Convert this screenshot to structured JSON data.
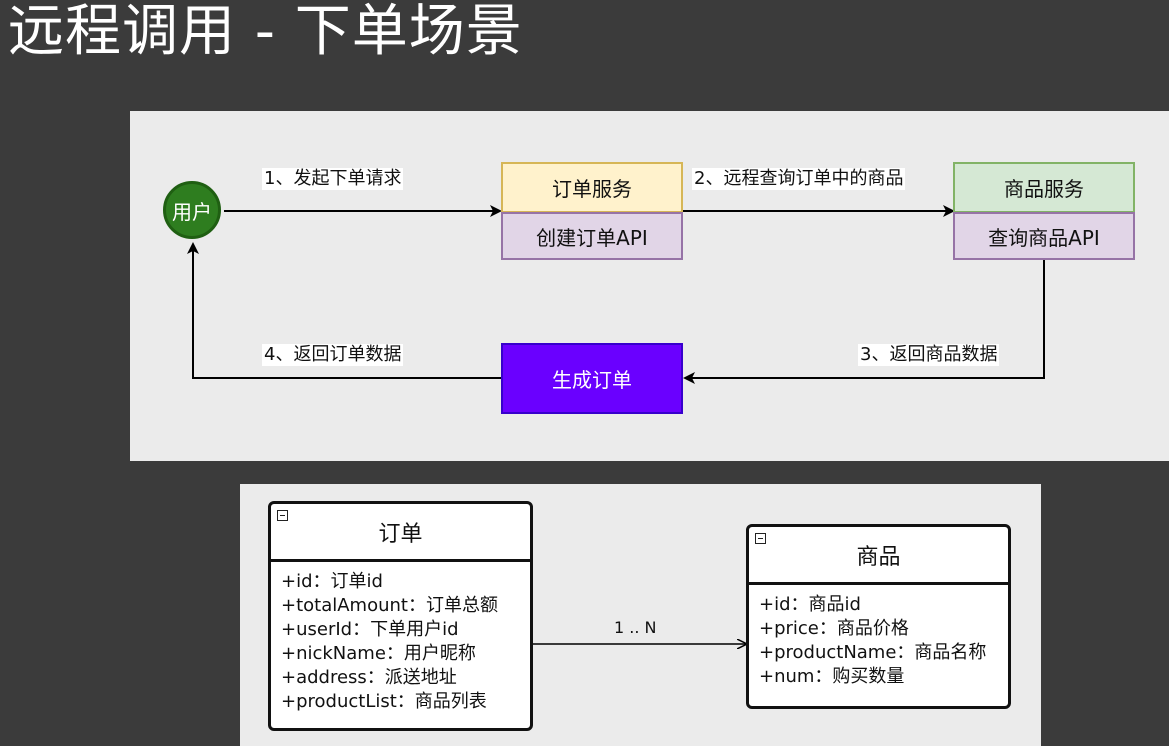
{
  "title": "远程调用 - 下单场景",
  "flow": {
    "user_label": "用户",
    "order_service": {
      "title": "订单服务",
      "api": "创建订单API"
    },
    "product_service": {
      "title": "商品服务",
      "api": "查询商品API"
    },
    "generate_order": "生成订单",
    "edges": {
      "step1": "1、发起下单请求",
      "step2": "2、远程查询订单中的商品",
      "step3": "3、返回商品数据",
      "step4": "4、返回订单数据"
    },
    "colors": {
      "user_fill": "#2e7d1f",
      "service_title_order": "#fff2cc",
      "service_title_product": "#d5e8d4",
      "api_fill": "#e1d5e7",
      "generate_fill": "#6a00ff"
    }
  },
  "uml": {
    "order_class": {
      "name": "订单",
      "fields": [
        "+id：订单id",
        "+totalAmount：订单总额",
        "+userId：下单用户id",
        "+nickName：用户昵称",
        "+address：派送地址",
        "+productList：商品列表"
      ]
    },
    "product_class": {
      "name": "商品",
      "fields": [
        "+id：商品id",
        "+price：商品价格",
        "+productName：商品名称",
        "+num：购买数量"
      ]
    },
    "association": "1 .. N"
  }
}
